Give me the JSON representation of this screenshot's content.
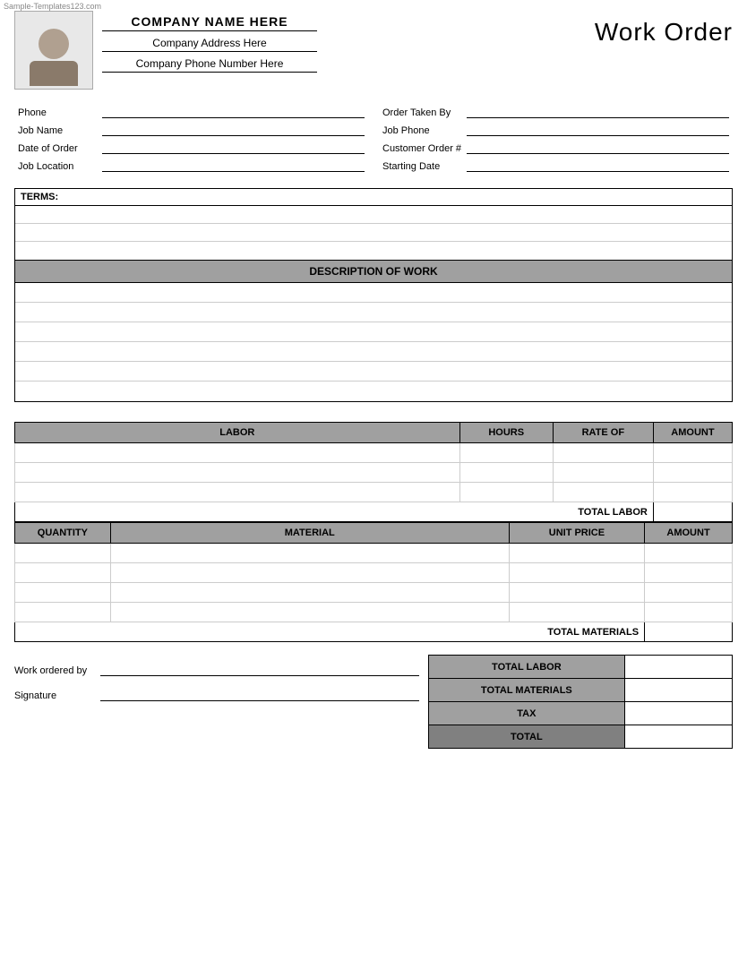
{
  "watermark": "Sample-Templates123.com",
  "header": {
    "company_name": "COMPANY NAME HERE",
    "company_address": "Company Address Here",
    "company_phone": "Company Phone Number Here",
    "title": "Work Order"
  },
  "form": {
    "left": [
      {
        "label": "Phone",
        "value": ""
      },
      {
        "label": "Order Taken By",
        "value": ""
      },
      {
        "label": "Job Name",
        "value": ""
      },
      {
        "label": "Job Phone",
        "value": ""
      }
    ],
    "right": [
      {
        "label": "Date of Order",
        "value": ""
      },
      {
        "label": "Customer Order #",
        "value": ""
      },
      {
        "label": "Job Location",
        "value": ""
      },
      {
        "label": "Starting Date",
        "value": ""
      }
    ]
  },
  "terms": {
    "label": "TERMS:",
    "rows": [
      "",
      "",
      ""
    ]
  },
  "description": {
    "header": "DESCRIPTION OF WORK",
    "rows": [
      "",
      "",
      "",
      "",
      "",
      ""
    ]
  },
  "labor": {
    "columns": [
      "LABOR",
      "HOURS",
      "RATE OF",
      "AMOUNT"
    ],
    "rows": [
      {
        "labor": "",
        "hours": "",
        "rate": "",
        "amount": ""
      },
      {
        "labor": "",
        "hours": "",
        "rate": "",
        "amount": ""
      },
      {
        "labor": "",
        "hours": "",
        "rate": "",
        "amount": ""
      }
    ],
    "total_label": "TOTAL LABOR"
  },
  "materials": {
    "columns": [
      "QUANTITY",
      "MATERIAL",
      "UNIT PRICE",
      "AMOUNT"
    ],
    "rows": [
      {
        "qty": "",
        "material": "",
        "unit_price": "",
        "amount": ""
      },
      {
        "qty": "",
        "material": "",
        "unit_price": "",
        "amount": ""
      },
      {
        "qty": "",
        "material": "",
        "unit_price": "",
        "amount": ""
      },
      {
        "qty": "",
        "material": "",
        "unit_price": "",
        "amount": ""
      }
    ],
    "total_label": "TOTAL MATERIALS"
  },
  "summary": {
    "rows": [
      {
        "label": "TOTAL LABOR",
        "value": ""
      },
      {
        "label": "TOTAL MATERIALS",
        "value": ""
      },
      {
        "label": "TAX",
        "value": ""
      },
      {
        "label": "TOTAL",
        "value": "",
        "is_total": true
      }
    ]
  },
  "signature": {
    "work_ordered_by_label": "Work ordered by",
    "signature_label": "Signature"
  }
}
